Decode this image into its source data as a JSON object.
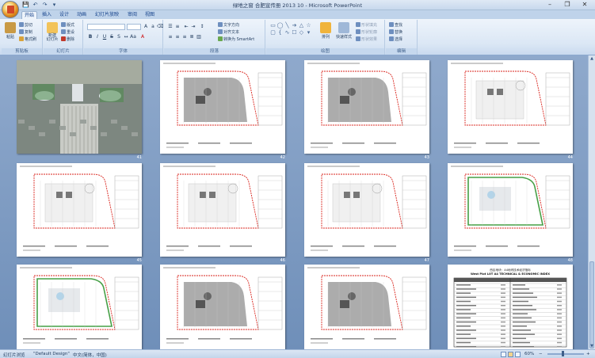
{
  "window": {
    "title": "绿地之窗 合肥宣传册 2013 10 - Microsoft PowerPoint",
    "minimize": "–",
    "restore": "❐",
    "close": "✕"
  },
  "qat": [
    "💾",
    "↶",
    "↷",
    "▾"
  ],
  "tabs": [
    "开始",
    "插入",
    "设计",
    "动画",
    "幻灯片放映",
    "审阅",
    "视图"
  ],
  "ribbon": {
    "clipboard": {
      "label": "剪贴板",
      "paste": "粘贴",
      "cut": "剪切",
      "copy": "复制",
      "format_painter": "格式刷"
    },
    "slides": {
      "label": "幻灯片",
      "new_slide": "新建\n幻灯片",
      "layout": "版式",
      "reset": "重设",
      "delete": "删除"
    },
    "font": {
      "label": "字体",
      "font_name": "",
      "font_size": ""
    },
    "paragraph": {
      "label": "段落",
      "text_direction": "文字方向",
      "align_text": "对齐文本",
      "smartart": "转换为 SmartArt"
    },
    "drawing": {
      "label": "绘图",
      "arrange": "排列",
      "quick_styles": "快速样式",
      "fill": "形状填充",
      "outline": "形状轮廓",
      "effects": "形状效果"
    },
    "editing": {
      "label": "编辑",
      "find": "查找",
      "replace": "替换",
      "select": "选择"
    }
  },
  "slides": [
    {
      "num": "41",
      "kind": "aerial"
    },
    {
      "num": "42",
      "kind": "plan-gray"
    },
    {
      "num": "43",
      "kind": "plan-gray"
    },
    {
      "num": "44",
      "kind": "plan-red"
    },
    {
      "num": "45",
      "kind": "plan-red"
    },
    {
      "num": "46",
      "kind": "plan-red"
    },
    {
      "num": "47",
      "kind": "plan-red"
    },
    {
      "num": "48",
      "kind": "plan-green"
    },
    {
      "num": "",
      "kind": "plan-green"
    },
    {
      "num": "",
      "kind": "plan-gray"
    },
    {
      "num": "",
      "kind": "plan-gray"
    },
    {
      "num": "",
      "kind": "table"
    }
  ],
  "table_slide": {
    "title_cn": "西区地块：A4地块技术经济指标",
    "title_en": "West Plot LOT A4 TECHNICAL & ECONOMIC INDEX"
  },
  "statusbar": {
    "view": "幻灯片浏览",
    "theme": "\"Default Design\"",
    "language": "中文(简体，中国)",
    "zoom": "60%",
    "zoom_out": "−",
    "zoom_in": "+"
  },
  "colors": {
    "accent": "#15428b",
    "workspace": "#7b98c1",
    "redline": "#d9231b"
  }
}
